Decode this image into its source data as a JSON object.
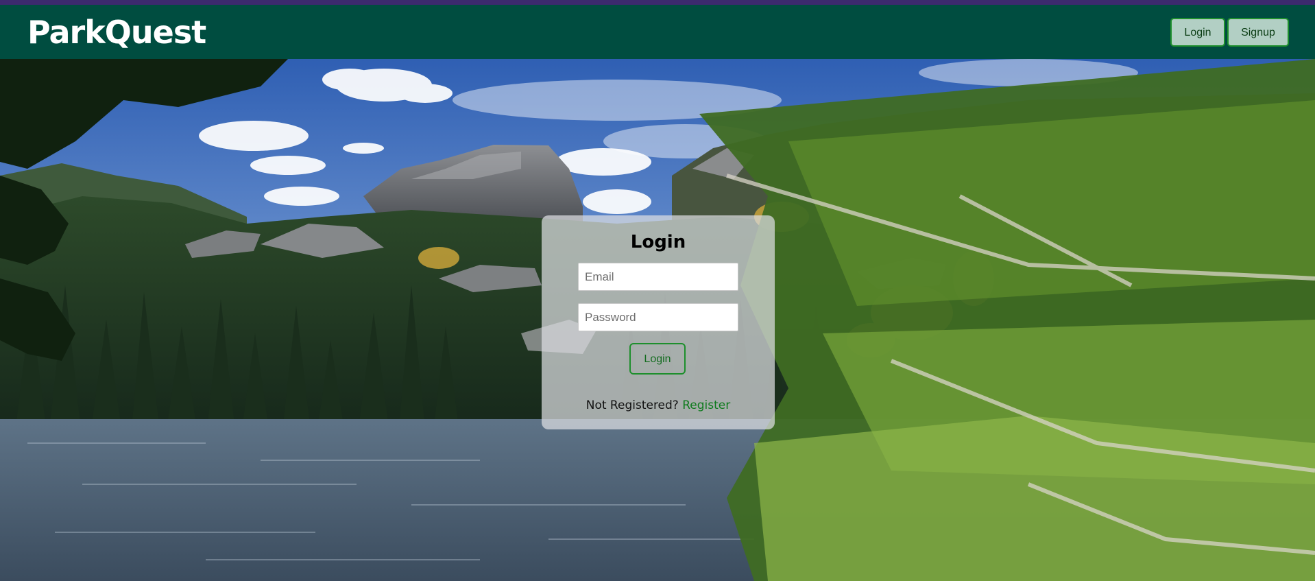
{
  "app": {
    "brand": "ParkQuest"
  },
  "nav": {
    "login_label": "Login",
    "signup_label": "Signup"
  },
  "login_form": {
    "title": "Login",
    "email_placeholder": "Email",
    "password_placeholder": "Password",
    "submit_label": "Login",
    "register_prompt": "Not Registered?",
    "register_link": "Register"
  },
  "hero": {
    "icon": "mountain-lake-landscape-icon"
  },
  "colors": {
    "top_strip": "#3c2a6e",
    "navbar": "#004d40",
    "nav_button_bg": "#b2cfc4",
    "accent_green": "#1d8f2c",
    "link_green": "#0d7a1c"
  }
}
